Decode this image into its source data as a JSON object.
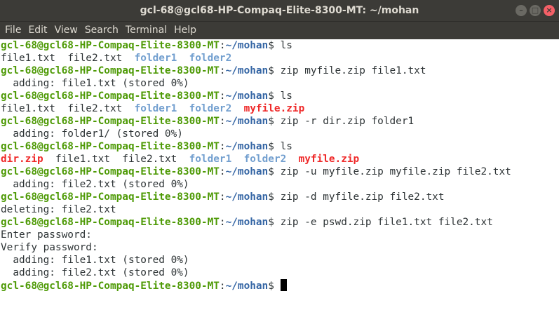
{
  "window": {
    "title": "gcl-68@gcl68-HP-Compaq-Elite-8300-MT: ~/mohan",
    "controls": [
      "–",
      "□",
      "×"
    ]
  },
  "menu": [
    "File",
    "Edit",
    "View",
    "Search",
    "Terminal",
    "Help"
  ],
  "prompt": {
    "user": "gcl-68@gcl68-HP-Compaq-Elite-8300-MT",
    "colon": ":",
    "path": "~/mohan",
    "dollar": "$ "
  },
  "lines": [
    {
      "type": "prompt",
      "cmd": "ls"
    },
    {
      "type": "ls",
      "items": [
        {
          "name": "file1.txt",
          "kind": "file"
        },
        {
          "name": "file2.txt",
          "kind": "file"
        },
        {
          "name": "folder1",
          "kind": "dir"
        },
        {
          "name": "folder2",
          "kind": "dir"
        }
      ]
    },
    {
      "type": "prompt",
      "cmd": "zip myfile.zip file1.txt"
    },
    {
      "type": "out",
      "text": "  adding: file1.txt (stored 0%)"
    },
    {
      "type": "prompt",
      "cmd": "ls"
    },
    {
      "type": "ls",
      "items": [
        {
          "name": "file1.txt",
          "kind": "file"
        },
        {
          "name": "file2.txt",
          "kind": "file"
        },
        {
          "name": "folder1",
          "kind": "dir"
        },
        {
          "name": "folder2",
          "kind": "dir"
        },
        {
          "name": "myfile.zip",
          "kind": "zip"
        }
      ]
    },
    {
      "type": "prompt",
      "cmd": "zip -r dir.zip folder1"
    },
    {
      "type": "out",
      "text": "  adding: folder1/ (stored 0%)"
    },
    {
      "type": "prompt",
      "cmd": "ls"
    },
    {
      "type": "ls",
      "items": [
        {
          "name": "dir.zip",
          "kind": "zip"
        },
        {
          "name": "file1.txt",
          "kind": "file"
        },
        {
          "name": "file2.txt",
          "kind": "file"
        },
        {
          "name": "folder1",
          "kind": "dir"
        },
        {
          "name": "folder2",
          "kind": "dir"
        },
        {
          "name": "myfile.zip",
          "kind": "zip"
        }
      ]
    },
    {
      "type": "prompt",
      "cmd": "zip -u myfile.zip myfile.zip file2.txt"
    },
    {
      "type": "out",
      "text": "  adding: file2.txt (stored 0%)"
    },
    {
      "type": "prompt",
      "cmd": "zip -d myfile.zip file2.txt"
    },
    {
      "type": "out",
      "text": "deleting: file2.txt"
    },
    {
      "type": "prompt",
      "cmd": "zip -e pswd.zip file1.txt file2.txt"
    },
    {
      "type": "out",
      "text": "Enter password:"
    },
    {
      "type": "out",
      "text": "Verify password:"
    },
    {
      "type": "out",
      "text": "  adding: file1.txt (stored 0%)"
    },
    {
      "type": "out",
      "text": "  adding: file2.txt (stored 0%)"
    },
    {
      "type": "prompt",
      "cmd": "",
      "cursor": true
    }
  ],
  "colors": {
    "titlebar": "#3c3b37",
    "prompt_user": "#4e9a06",
    "prompt_path": "#3465a4",
    "dir": "#729fcf",
    "zip": "#ef2929"
  }
}
